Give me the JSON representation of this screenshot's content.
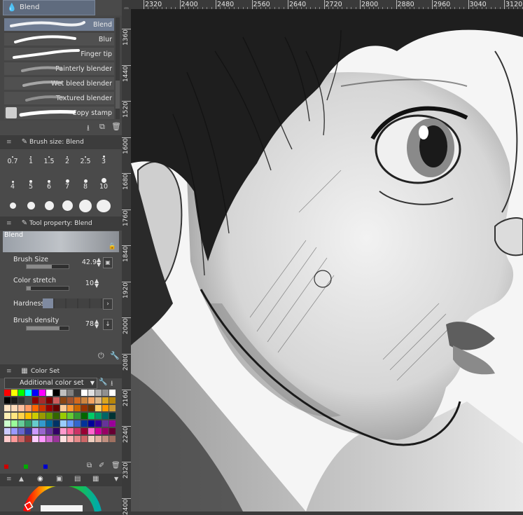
{
  "subtool_panel": {
    "tab_label": "Blend",
    "brushes": [
      {
        "label": "Blend",
        "selected": true
      },
      {
        "label": "Blur",
        "selected": false
      },
      {
        "label": "Finger tip",
        "selected": false
      },
      {
        "label": "Painterly blender",
        "selected": false
      },
      {
        "label": "Wet bleed blender",
        "selected": false
      },
      {
        "label": "Textured blender",
        "selected": false
      },
      {
        "label": "Copy stamp",
        "selected": false
      }
    ]
  },
  "brush_size_panel": {
    "title": "Brush size: Blend",
    "row1": [
      "0.7",
      "1",
      "1.5",
      "2",
      "2.5",
      "3"
    ],
    "row2": [
      "4",
      "5",
      "6",
      "7",
      "8",
      "10"
    ]
  },
  "tool_property_panel": {
    "title": "Tool property: Blend",
    "preview_label": "Blend",
    "brush_size": {
      "label": "Brush Size",
      "value": "42.9",
      "level": 0.6
    },
    "color_stretch": {
      "label": "Color stretch",
      "value": "10",
      "level": 0.1
    },
    "hardness": {
      "label": "Hardness",
      "level": 0.2
    },
    "brush_density": {
      "label": "Brush density",
      "value": "78",
      "level": 0.78
    }
  },
  "color_set_panel": {
    "title": "Color Set",
    "set_name": "Additional color set"
  },
  "ruler_top": {
    "ticks": [
      "2320",
      "2400",
      "2480",
      "2560",
      "2640",
      "2720",
      "2800",
      "2880",
      "2960",
      "3040",
      "3120"
    ]
  },
  "ruler_left": {
    "ticks": [
      "1360",
      "1440",
      "1520",
      "1600",
      "1680",
      "1760",
      "1840",
      "1920",
      "2000",
      "2080",
      "2160",
      "2240",
      "2320",
      "2400"
    ]
  },
  "colors": {
    "panel_bg": "#4a4a4a",
    "selection": "#6f7c92",
    "canvas_bg": "#ececec"
  }
}
